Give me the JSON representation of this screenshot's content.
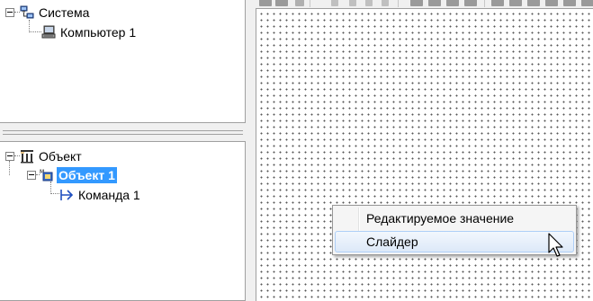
{
  "system_tree": {
    "root_label": "Система",
    "child_label": "Компьютер 1"
  },
  "object_tree": {
    "root_label": "Объект",
    "selected_label": "Объект 1",
    "child_label": "Команда 1"
  },
  "context_menu": {
    "items": [
      {
        "label": "Редактируемое значение",
        "hovered": false
      },
      {
        "label": "Слайдер",
        "hovered": true
      }
    ]
  },
  "colors": {
    "selection": "#3399ff",
    "menu_hover_border": "#aecff7"
  },
  "icons": {
    "system": "network-computer-icon",
    "computer": "computer-icon",
    "object": "object-tree-icon",
    "module": "module-icon",
    "command": "command-arrow-icon"
  }
}
